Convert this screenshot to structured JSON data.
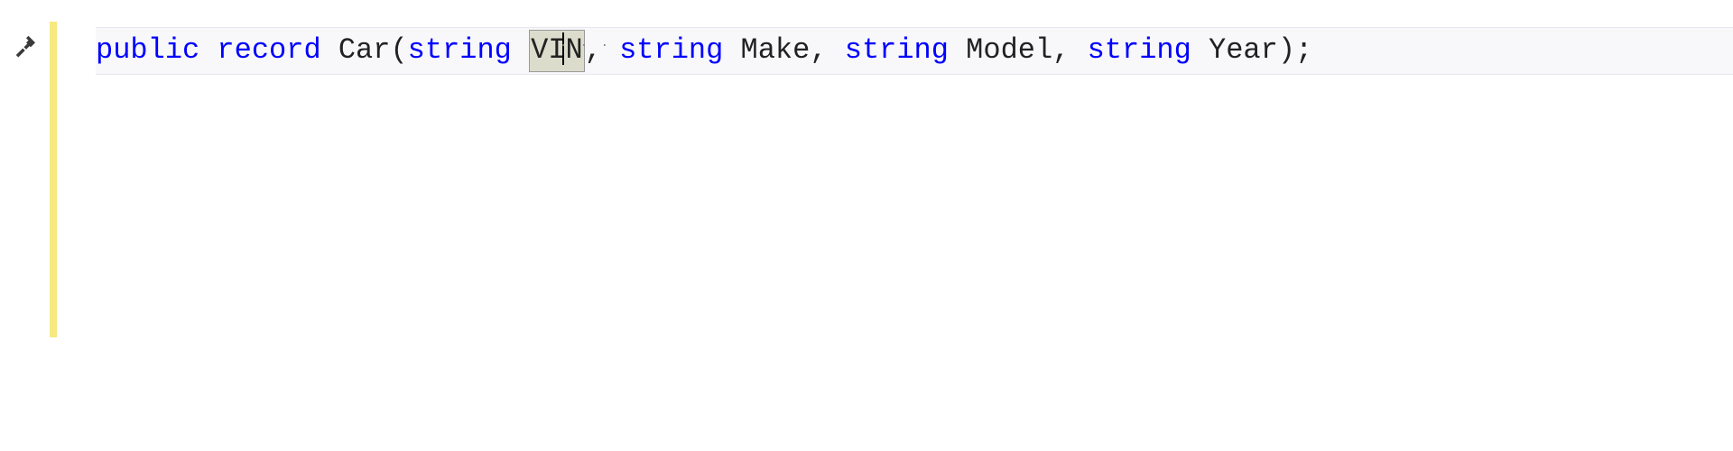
{
  "gutter": {
    "quick_action_tooltip": "Quick Actions"
  },
  "code": {
    "tokens": {
      "public": "public",
      "record": "record",
      "class_name": "Car",
      "open_paren": "(",
      "string1": "string",
      "param1": "VIN",
      "comma1": ", ",
      "string2": "string",
      "param2": "Make",
      "comma2": ", ",
      "string3": "string",
      "param3": "Model",
      "comma3": ", ",
      "string4": "string",
      "param4": "Year",
      "close": ");"
    },
    "param_hint_dots": ". . ."
  }
}
